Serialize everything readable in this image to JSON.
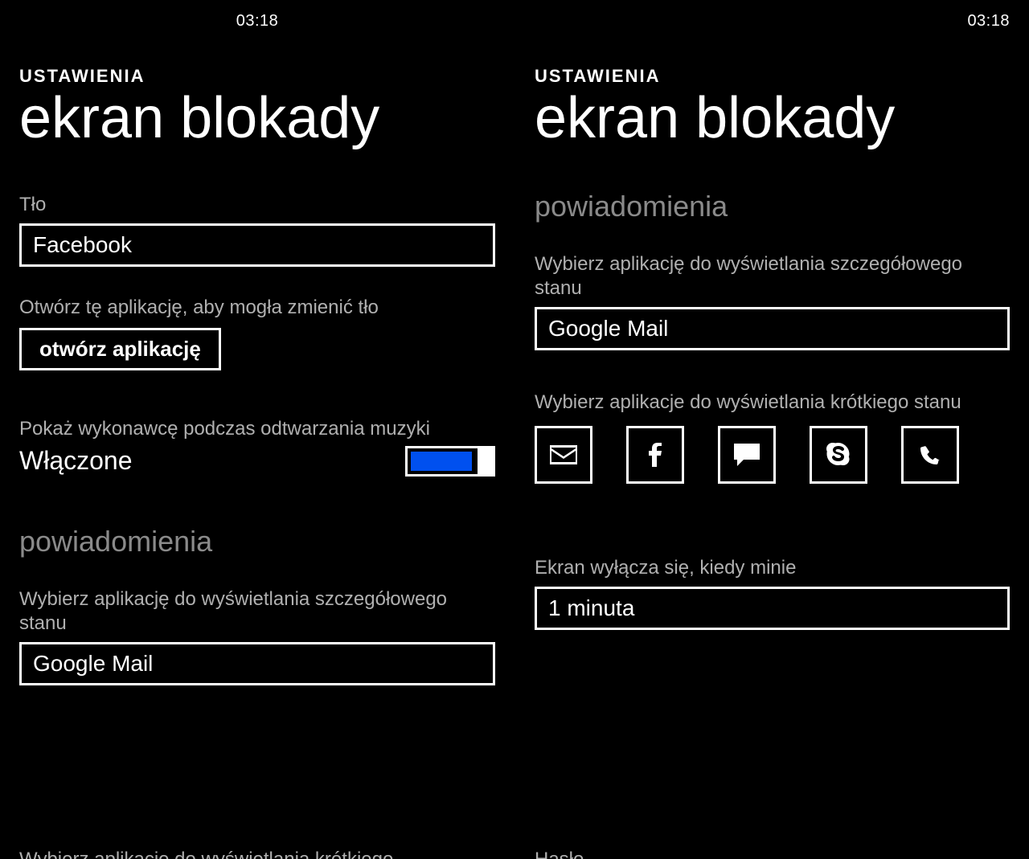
{
  "left": {
    "clock": "03:18",
    "section": "USTAWIENIA",
    "title": "ekran blokady",
    "background_label": "Tło",
    "background_value": "Facebook",
    "open_app_hint": "Otwórz tę aplikację, aby mogła zmienić tło",
    "open_app_button": "otwórz aplikację",
    "artist_label": "Pokaż wykonawcę podczas odtwarzania muzyki",
    "artist_value": "Włączone",
    "notifications_heading": "powiadomienia",
    "detailed_label": "Wybierz aplikację do wyświetlania szczegółowego stanu",
    "detailed_value": "Google Mail",
    "cutoff_text": "Wybierz aplikacje do wyświetlania krótkiego"
  },
  "right": {
    "clock": "03:18",
    "section": "USTAWIENIA",
    "title": "ekran blokady",
    "notifications_heading": "powiadomienia",
    "detailed_label": "Wybierz aplikację do wyświetlania szczegółowego stanu",
    "detailed_value": "Google Mail",
    "quick_label": "Wybierz aplikacje do wyświetlania krótkiego stanu",
    "quick_icons": [
      "mail-icon",
      "facebook-icon",
      "messaging-icon",
      "skype-icon",
      "phone-icon"
    ],
    "timeout_label": "Ekran wyłącza się, kiedy minie",
    "timeout_value": "1 minuta",
    "cutoff_text": "Hasło"
  },
  "colors": {
    "accent": "#0050ef",
    "muted": "#8a8a8a",
    "label": "#b0b0b0"
  }
}
